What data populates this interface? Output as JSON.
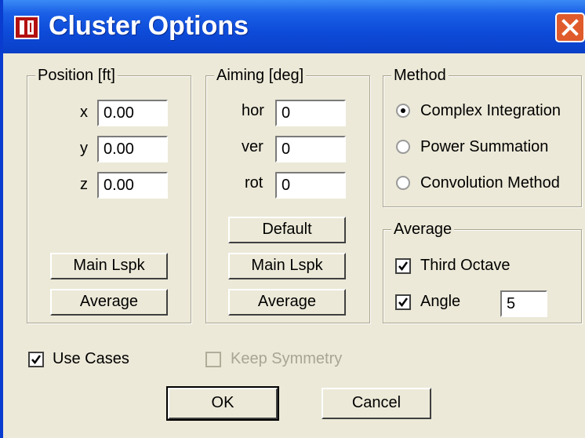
{
  "window": {
    "title": "Cluster Options"
  },
  "position": {
    "legend": "Position [ft]",
    "x_label": "x",
    "x_value": "0.00",
    "y_label": "y",
    "y_value": "0.00",
    "z_label": "z",
    "z_value": "0.00",
    "main_lspk": "Main Lspk",
    "average": "Average"
  },
  "aiming": {
    "legend": "Aiming [deg]",
    "hor_label": "hor",
    "hor_value": "0",
    "ver_label": "ver",
    "ver_value": "0",
    "rot_label": "rot",
    "rot_value": "0",
    "default": "Default",
    "main_lspk": "Main Lspk",
    "average": "Average"
  },
  "method": {
    "legend": "Method",
    "options": [
      "Complex Integration",
      "Power Summation",
      "Convolution Method"
    ],
    "selected": "Complex Integration"
  },
  "average_group": {
    "legend": "Average",
    "third_octave": "Third Octave",
    "third_octave_checked": true,
    "angle": "Angle",
    "angle_checked": true,
    "angle_value": "5"
  },
  "use_cases": {
    "label": "Use Cases",
    "checked": true
  },
  "keep_symmetry": {
    "label": "Keep Symmetry",
    "checked": false,
    "enabled": false
  },
  "buttons": {
    "ok": "OK",
    "cancel": "Cancel"
  },
  "colors": {
    "titlebar": "#0a3fc8",
    "face": "#ece9d8",
    "close": "#e05b2b"
  }
}
